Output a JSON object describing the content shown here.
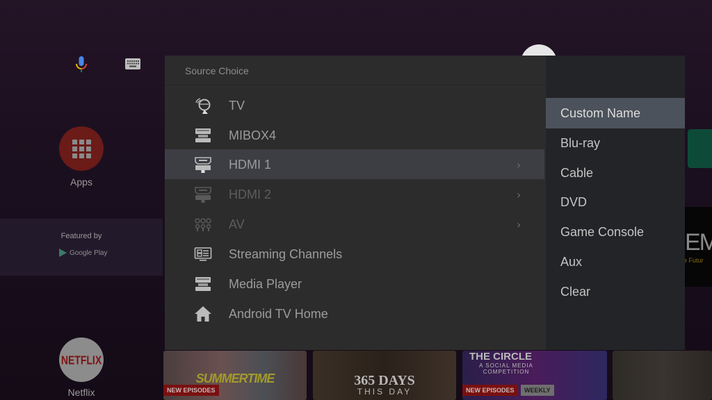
{
  "home": {
    "apps_label": "Apps",
    "featured_title": "Featured by",
    "featured_brand": "Google Play",
    "netflix_logo": "NETFLIX",
    "netflix_label": "Netflix",
    "tiles": [
      {
        "title": "SUMMERTIME",
        "badges": [
          "NEW EPISODES"
        ]
      },
      {
        "title": "365 DAYS",
        "subtitle": "THIS DAY",
        "badges": []
      },
      {
        "title": "THE CIRCLE",
        "subtitle": "A SOCIAL MEDIA COMPETITION",
        "badges": [
          "NEW EPISODES",
          "WEEKLY"
        ]
      },
      {
        "title": "",
        "badges": []
      }
    ],
    "side_banner_text": "EM",
    "side_banner_subtext": "e Futur"
  },
  "dialog": {
    "title": "Source Choice",
    "items": [
      {
        "label": "TV",
        "icon": "satellite-dish-icon",
        "state": "normal",
        "has_submenu": false
      },
      {
        "label": "MIBOX4",
        "icon": "set-top-box-icon",
        "state": "normal",
        "has_submenu": false
      },
      {
        "label": "HDMI 1",
        "icon": "hdmi-icon",
        "state": "selected",
        "has_submenu": true
      },
      {
        "label": "HDMI 2",
        "icon": "hdmi-icon",
        "state": "disabled",
        "has_submenu": true
      },
      {
        "label": "AV",
        "icon": "av-jacks-icon",
        "state": "disabled",
        "has_submenu": true
      },
      {
        "label": "Streaming Channels",
        "icon": "streaming-channels-icon",
        "state": "normal",
        "has_submenu": false
      },
      {
        "label": "Media Player",
        "icon": "media-player-icon",
        "state": "normal",
        "has_submenu": false
      },
      {
        "label": "Android TV Home",
        "icon": "home-icon",
        "state": "normal",
        "has_submenu": false
      }
    ]
  },
  "submenu": {
    "items": [
      {
        "label": "Custom Name",
        "selected": true
      },
      {
        "label": "Blu-ray",
        "selected": false
      },
      {
        "label": "Cable",
        "selected": false
      },
      {
        "label": "DVD",
        "selected": false
      },
      {
        "label": "Game Console",
        "selected": false
      },
      {
        "label": "Aux",
        "selected": false
      },
      {
        "label": "Clear",
        "selected": false
      }
    ]
  },
  "colors": {
    "dialog_bg": "#2c2c2c",
    "submenu_bg": "#232427",
    "selected_row": "#3d3e44",
    "submenu_selected": "#4b525b"
  }
}
